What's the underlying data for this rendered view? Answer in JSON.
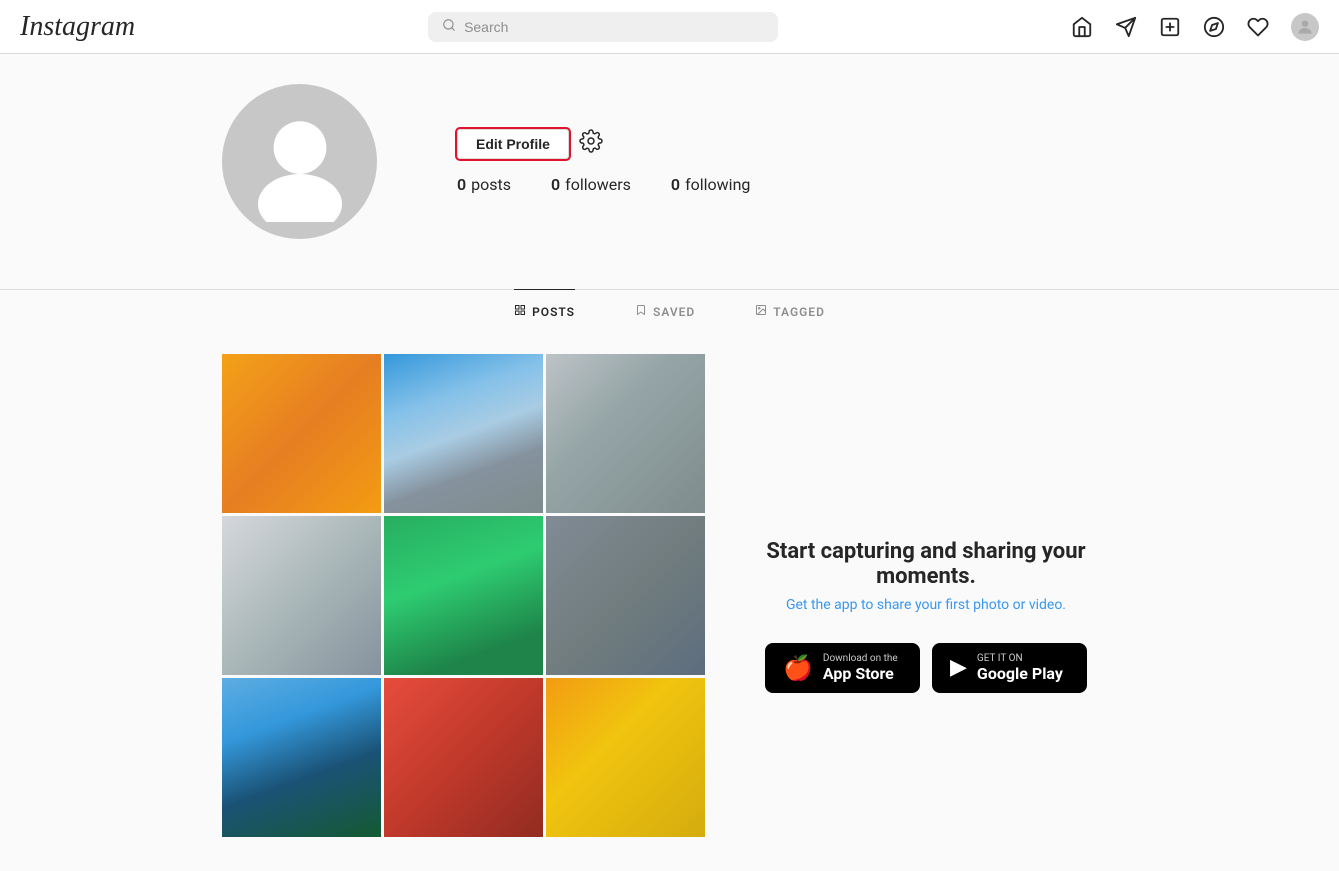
{
  "app": {
    "logo": "Instagram"
  },
  "header": {
    "search_placeholder": "Search",
    "nav_icons": [
      "home",
      "direct",
      "new-post",
      "explore",
      "heart",
      "avatar"
    ]
  },
  "profile": {
    "edit_button_label": "Edit Profile",
    "stats": {
      "posts_count": "0",
      "posts_label": "posts",
      "followers_count": "0",
      "followers_label": "followers",
      "following_count": "0",
      "following_label": "following"
    }
  },
  "tabs": [
    {
      "id": "posts",
      "label": "POSTS",
      "active": true
    },
    {
      "id": "saved",
      "label": "SAVED",
      "active": false
    },
    {
      "id": "tagged",
      "label": "TAGGED",
      "active": false
    }
  ],
  "promo": {
    "title": "Start capturing and sharing your moments.",
    "subtitle": "Get the app to share your first photo or video.",
    "app_store_label": "Download on the",
    "app_store_name": "App Store",
    "google_play_label": "GET IT ON",
    "google_play_name": "Google Play"
  }
}
